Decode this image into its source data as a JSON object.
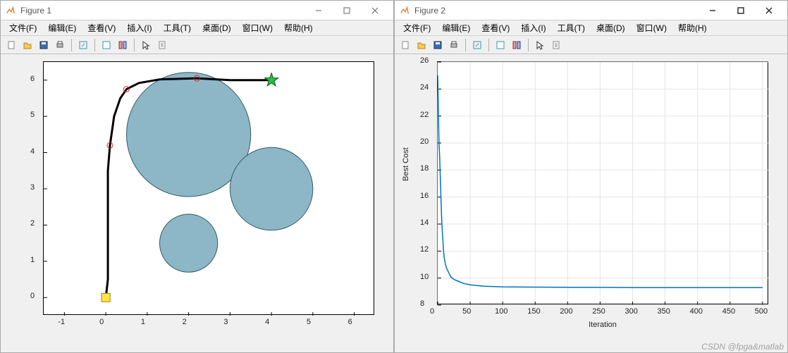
{
  "windows": [
    {
      "title": "Figure 1"
    },
    {
      "title": "Figure 2"
    }
  ],
  "menu": {
    "file": "文件(F)",
    "edit": "编辑(E)",
    "view": "查看(V)",
    "insert": "插入(I)",
    "tools": "工具(T)",
    "desktop": "桌面(D)",
    "window": "窗口(W)",
    "help": "帮助(H)"
  },
  "toolbar_icons": [
    "new-file",
    "open-folder",
    "save",
    "print",
    "sep",
    "link",
    "sep",
    "window-single",
    "window-tile",
    "sep",
    "pointer",
    "document"
  ],
  "watermark": "CSDN @fpga&matlab",
  "chart_data": [
    {
      "type": "scatter",
      "title": "",
      "xlabel": "",
      "ylabel": "",
      "xlim": [
        -1.5,
        6.5
      ],
      "ylim": [
        -0.5,
        6.5
      ],
      "xticks": [
        -1,
        0,
        1,
        2,
        3,
        4,
        5,
        6
      ],
      "yticks": [
        0,
        1,
        2,
        3,
        4,
        5,
        6
      ],
      "obstacles": [
        {
          "cx": 2.0,
          "cy": 4.5,
          "r": 1.5,
          "fill": "#8db7c6",
          "stroke": "#305a6b"
        },
        {
          "cx": 4.0,
          "cy": 3.0,
          "r": 1.0,
          "fill": "#8db7c6",
          "stroke": "#305a6b"
        },
        {
          "cx": 2.0,
          "cy": 1.5,
          "r": 0.7,
          "fill": "#8db7c6",
          "stroke": "#305a6b"
        }
      ],
      "start": {
        "x": 0,
        "y": 0,
        "marker": "yellow-square"
      },
      "goal": {
        "x": 4,
        "y": 6,
        "marker": "green-pentagram"
      },
      "waypoints": [
        {
          "x": 0.1,
          "y": 4.2
        },
        {
          "x": 0.5,
          "y": 5.75
        },
        {
          "x": 2.2,
          "y": 6.05
        }
      ],
      "path": [
        {
          "x": 0.0,
          "y": 0.0
        },
        {
          "x": 0.05,
          "y": 0.5
        },
        {
          "x": 0.05,
          "y": 1.5
        },
        {
          "x": 0.05,
          "y": 2.5
        },
        {
          "x": 0.05,
          "y": 3.5
        },
        {
          "x": 0.1,
          "y": 4.2
        },
        {
          "x": 0.2,
          "y": 5.0
        },
        {
          "x": 0.35,
          "y": 5.5
        },
        {
          "x": 0.5,
          "y": 5.75
        },
        {
          "x": 0.8,
          "y": 5.92
        },
        {
          "x": 1.3,
          "y": 6.02
        },
        {
          "x": 2.2,
          "y": 6.05
        },
        {
          "x": 3.0,
          "y": 6.0
        },
        {
          "x": 4.0,
          "y": 6.0
        }
      ],
      "path_color": "#000000",
      "path_width": 3
    },
    {
      "type": "line",
      "title": "",
      "xlabel": "Iteration",
      "ylabel": "Best Cost",
      "xlim": [
        0,
        510
      ],
      "ylim": [
        8,
        26
      ],
      "xticks": [
        0,
        50,
        100,
        150,
        200,
        250,
        300,
        350,
        400,
        450,
        500
      ],
      "yticks": [
        8,
        10,
        12,
        14,
        16,
        18,
        20,
        22,
        24,
        26
      ],
      "grid": true,
      "series": [
        {
          "name": "Best Cost",
          "color": "#0072bd",
          "x": [
            0,
            1,
            2,
            3,
            4,
            5,
            6,
            7,
            8,
            9,
            10,
            12,
            14,
            16,
            18,
            20,
            25,
            30,
            40,
            50,
            60,
            70,
            80,
            100,
            150,
            200,
            250,
            300,
            350,
            400,
            450,
            500
          ],
          "y": [
            25.0,
            22.5,
            20.0,
            19.0,
            17.5,
            16.0,
            14.5,
            13.5,
            12.8,
            12.0,
            11.5,
            11.0,
            10.7,
            10.5,
            10.3,
            10.1,
            9.9,
            9.8,
            9.6,
            9.5,
            9.45,
            9.4,
            9.38,
            9.35,
            9.33,
            9.32,
            9.31,
            9.3,
            9.3,
            9.3,
            9.3,
            9.3
          ]
        }
      ]
    }
  ]
}
